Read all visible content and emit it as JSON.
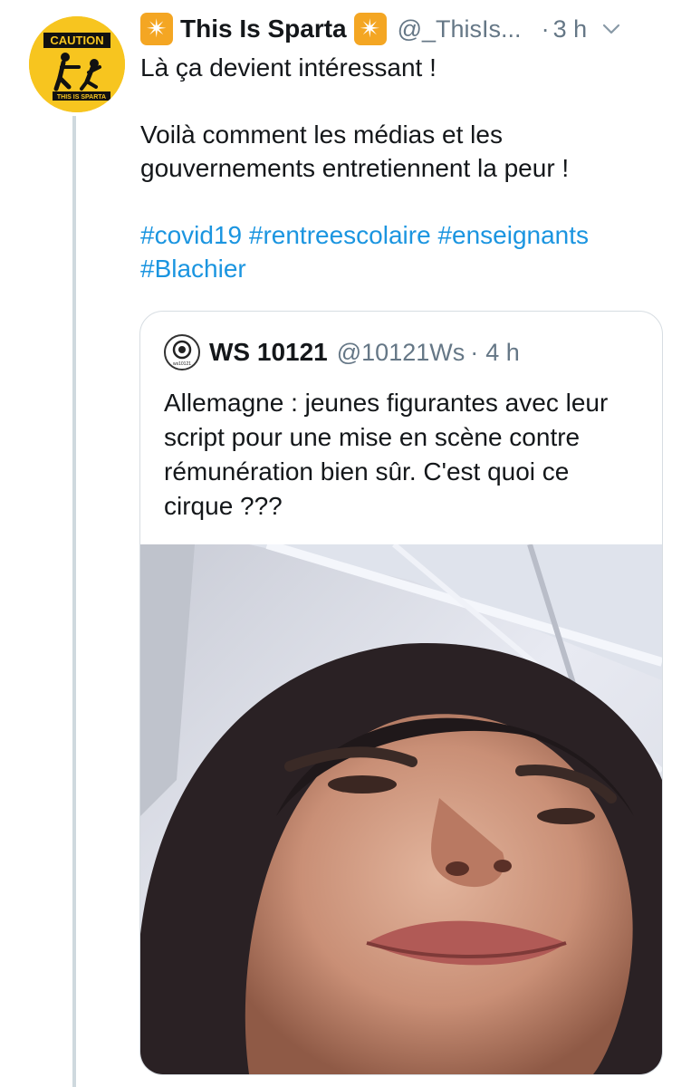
{
  "tweet": {
    "display_name": "This Is Sparta",
    "name_emoji_left": "✴",
    "name_emoji_right": "✴",
    "handle": "@_ThisIs...",
    "separator": "·",
    "time": "3 h",
    "avatar": {
      "caution_label": "CAUTION",
      "logo_text": "THIS IS SPARTA",
      "background_color": "#f7c51f"
    },
    "text_line_1": "Là ça devient intéressant !",
    "text_line_2": "Voilà comment les médias et les gouvernements entretiennent la peur !",
    "hashtags": [
      "#covid19",
      "#rentreescolaire",
      "#enseignants",
      "#Blachier"
    ]
  },
  "quoted_tweet": {
    "display_name": "WS 10121",
    "handle": "@10121Ws",
    "separator": "·",
    "time": "4 h",
    "avatar_text": "ws10121",
    "text": "Allemagne : jeunes figurantes avec leur script pour une mise en scène contre rémunération bien sûr. C'est quoi ce cirque ???",
    "media": {
      "kind": "video-still",
      "description_icon": "face-photo"
    }
  },
  "colors": {
    "text": "#14171a",
    "secondary": "#657786",
    "link": "#1b95e0",
    "thread_line": "#cfd9de",
    "card_border": "#d7dde2"
  }
}
